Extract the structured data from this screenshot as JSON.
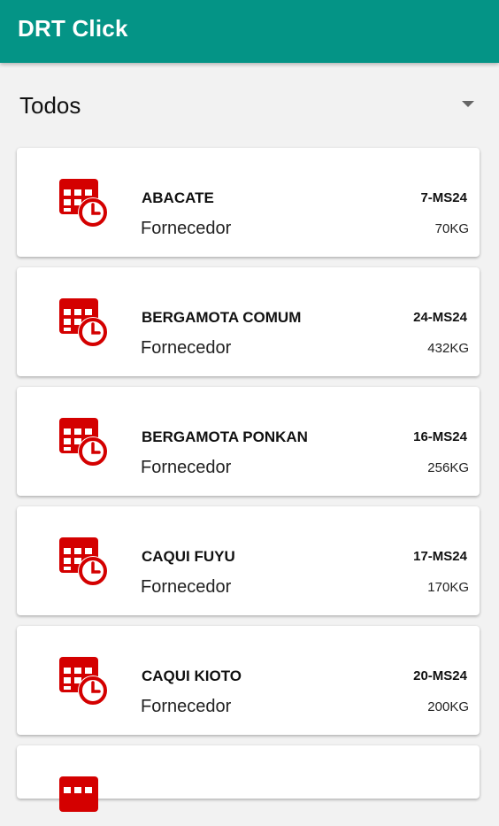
{
  "app_bar": {
    "title": "DRT Click",
    "color": "#049486"
  },
  "filter": {
    "selected": "Todos"
  },
  "icon_color": "#d40000",
  "items": [
    {
      "name": "ABACATE",
      "supplier": "Fornecedor",
      "code": "7-MS24",
      "weight": "70KG"
    },
    {
      "name": "BERGAMOTA COMUM",
      "supplier": "Fornecedor",
      "code": "24-MS24",
      "weight": "432KG"
    },
    {
      "name": "BERGAMOTA PONKAN",
      "supplier": "Fornecedor",
      "code": "16-MS24",
      "weight": "256KG"
    },
    {
      "name": "CAQUI FUYU",
      "supplier": "Fornecedor",
      "code": "17-MS24",
      "weight": "170KG"
    },
    {
      "name": "CAQUI KIOTO",
      "supplier": "Fornecedor",
      "code": "20-MS24",
      "weight": "200KG"
    }
  ]
}
